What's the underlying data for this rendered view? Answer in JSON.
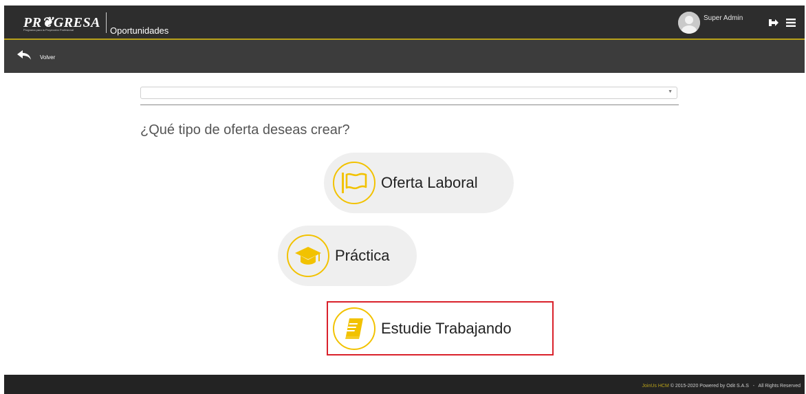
{
  "header": {
    "logo_text": "PROGRESA",
    "logo_tagline": "Programa para la Proyección Profesional",
    "module_title": "Oportunidades",
    "user_name": "Super Admin"
  },
  "subnav": {
    "back_label": "Volver"
  },
  "form": {
    "select_value": "",
    "question": "¿Qué tipo de oferta deseas crear?"
  },
  "options": [
    {
      "label": "Oferta Laboral",
      "icon": "flag-icon"
    },
    {
      "label": "Práctica",
      "icon": "graduation-cap-icon"
    },
    {
      "label": "Estudie Trabajando",
      "icon": "book-icon",
      "selected": true
    }
  ],
  "footer": {
    "brand": "JoinUs HCM",
    "copyright": "© 2015-2020 Powered by Odit S.A.S",
    "separator": "-",
    "rights": "All Rights Reserved"
  },
  "colors": {
    "accent": "#f2c200",
    "highlight_border": "#d9202a",
    "header_bg": "#2d2d2d",
    "subbar_bg": "#3c3c3c"
  }
}
